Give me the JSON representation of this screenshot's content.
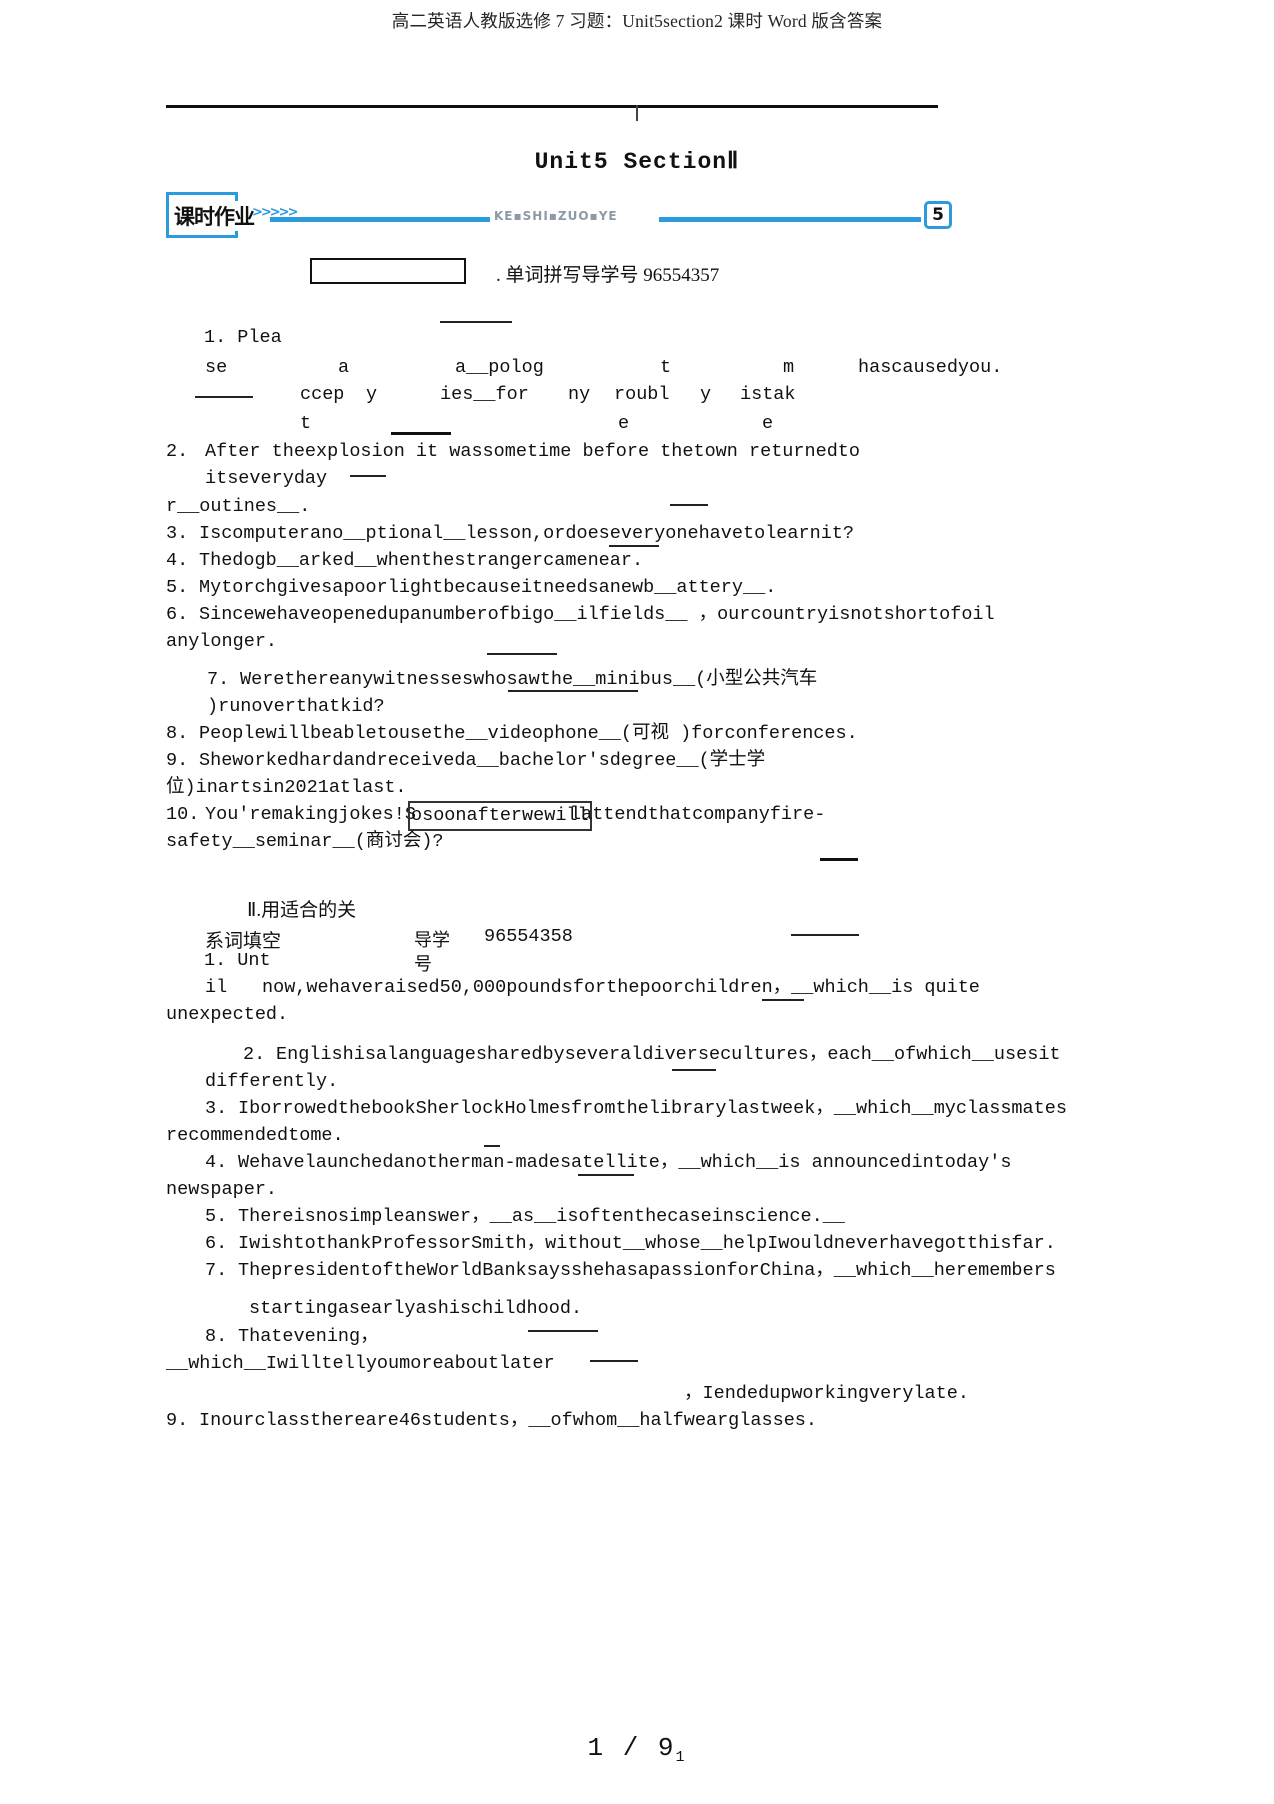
{
  "document": {
    "running_head": "高二英语人教版选修 7 习题：Unit5section2 课时 Word 版含答案",
    "unit_title": "Unit5  SectionⅡ"
  },
  "banner": {
    "label": "课时作业",
    "chevrons": ">>>>>",
    "pinyin_parts": [
      "KE",
      "SHI",
      "ZUO",
      "YE"
    ],
    "pinyin_text": "KE▪SHI▪ZUO▪YE",
    "badge": "5",
    "accent_color": "#2a9bdd",
    "pinyin_color": "#8d99a6"
  },
  "section_one": {
    "heading": ". 单词拼写导学号 96554357",
    "items": [
      {
        "number": "1. Plea",
        "frag_line1": "se",
        "frag_line1_b": "a",
        "frag_line1_c": "a__polog",
        "frag_line1_d": "t",
        "frag_line1_e": "m",
        "frag_line1_f": "hascausedyou.",
        "frag_line2_a": "ccep",
        "frag_line2_b": "y",
        "frag_line2_c": "ies__for",
        "frag_line2_d": "ny",
        "frag_line2_e": "roubl",
        "frag_line2_f": "y",
        "frag_line2_g": "istak",
        "frag_line3_a": "t",
        "frag_line3_b": "e",
        "frag_line3_c": "e"
      },
      {
        "number": "2.",
        "line1": "After   theexplosion   it  wassometime before  thetown returnedto",
        "line2": "itseveryday",
        "line3": "r__outines__."
      },
      {
        "number": "3.",
        "text": "Iscomputerano__ptional__lesson,ordoeseveryonehavetolearnit?"
      },
      {
        "number": "4.",
        "text": "Thedogb__arked__whenthestrangercamenear."
      },
      {
        "number": "5.",
        "text": "Mytorchgivesapoorlightbecauseitneedsanewb__attery__."
      },
      {
        "number": "6.",
        "line1": "Sincewehaveopenedupanumberofbigo__ilfields__ ，ourcountryisnotshortofoil",
        "line2": "anylonger."
      },
      {
        "number": "7.",
        "line1": "Werethereanywitnesseswhosawthe__minibus__(小型公共汽车",
        "line2": ")runoverthatkid?"
      },
      {
        "number": "8.",
        "text": "Peoplewillbeabletousethe__videophone__(可视  )forconferences."
      },
      {
        "number": "9.",
        "line1": "Sheworkedhardandreceiveda__bachelor'sdegree__(学士学",
        "line2": "位)inartsin2021atlast."
      },
      {
        "number": "10.",
        "line1_pre": "You'remakingjokes!S",
        "line1_box": "osoonafterwewill",
        "line1_post": "lattendthatcompanyfire-",
        "line2": "safety__seminar__(商讨会)?"
      }
    ]
  },
  "section_two": {
    "heading_a": "Ⅱ.用适合的关",
    "heading_b": "系词填空",
    "heading_c": "导学",
    "heading_d": "号",
    "heading_e": "96554358",
    "items": [
      {
        "number": "1. Unt",
        "frag_a": "il",
        "line1": "now,wehaveraised50,000poundsforthepoorchildren，__which__is quite",
        "line2": "unexpected."
      },
      {
        "number": "2.",
        "line1": "Englishisalanguagesharedbyseveraldiversecultures，each__ofwhich__usesit",
        "line2": "differently."
      },
      {
        "number": "3.",
        "line1": "IborrowedthebookSherlockHolmesfromthelibrarylastweek，__which__myclassmates",
        "line2": "recommendedtome."
      },
      {
        "number": "4.",
        "line1": "Wehavelaunchedanotherman-madesatellite，__which__is  announcedintoday's",
        "line2": "newspaper."
      },
      {
        "number": "5.",
        "text": "Thereisnosimpleanswer，__as__isoftenthecaseinscience.__"
      },
      {
        "number": "6.",
        "text": "IwishtothankProfessorSmith，without__whose__helpIwouldneverhavegotthisfar."
      },
      {
        "number": "7.",
        "line1": "ThepresidentoftheWorldBanksaysshehasapassionforChina，__which__heremembers",
        "line2": "startingasearlyashischildhood."
      },
      {
        "number": "8.",
        "line1": "Thatevening，",
        "line2": "__which__Iwilltellyoumoreaboutlater",
        "line3": "，Iendedupworkingverylate."
      },
      {
        "number": "9.",
        "text": "Inourclassthereare46students，__ofwhom__halfwearglasses."
      }
    ]
  },
  "footer": {
    "page_current": "1",
    "separator": "/",
    "page_total": "9",
    "trailing": "1"
  }
}
